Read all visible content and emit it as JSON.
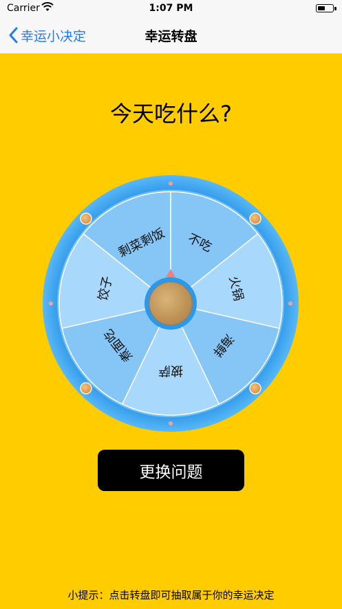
{
  "status_bar": {
    "carrier": "Carrier",
    "time": "1:07 PM"
  },
  "nav": {
    "back_label": "幸运小决定",
    "title": "幸运转盘"
  },
  "question": "今天吃什么?",
  "wheel": {
    "segments": [
      "不吃",
      "火锅",
      "海鲜",
      "披萨",
      "煮面吃",
      "饺子",
      "剩菜剩饭"
    ],
    "colors": {
      "rim": "#3AA6F2",
      "segment_light": "#A8D8FB",
      "segment_dark": "#85C6F7",
      "hub": "#C9A063",
      "pointer": "#F08080"
    }
  },
  "change_button": "更换问题",
  "hint": "小提示：点击转盘即可抽取属于你的幸运决定"
}
